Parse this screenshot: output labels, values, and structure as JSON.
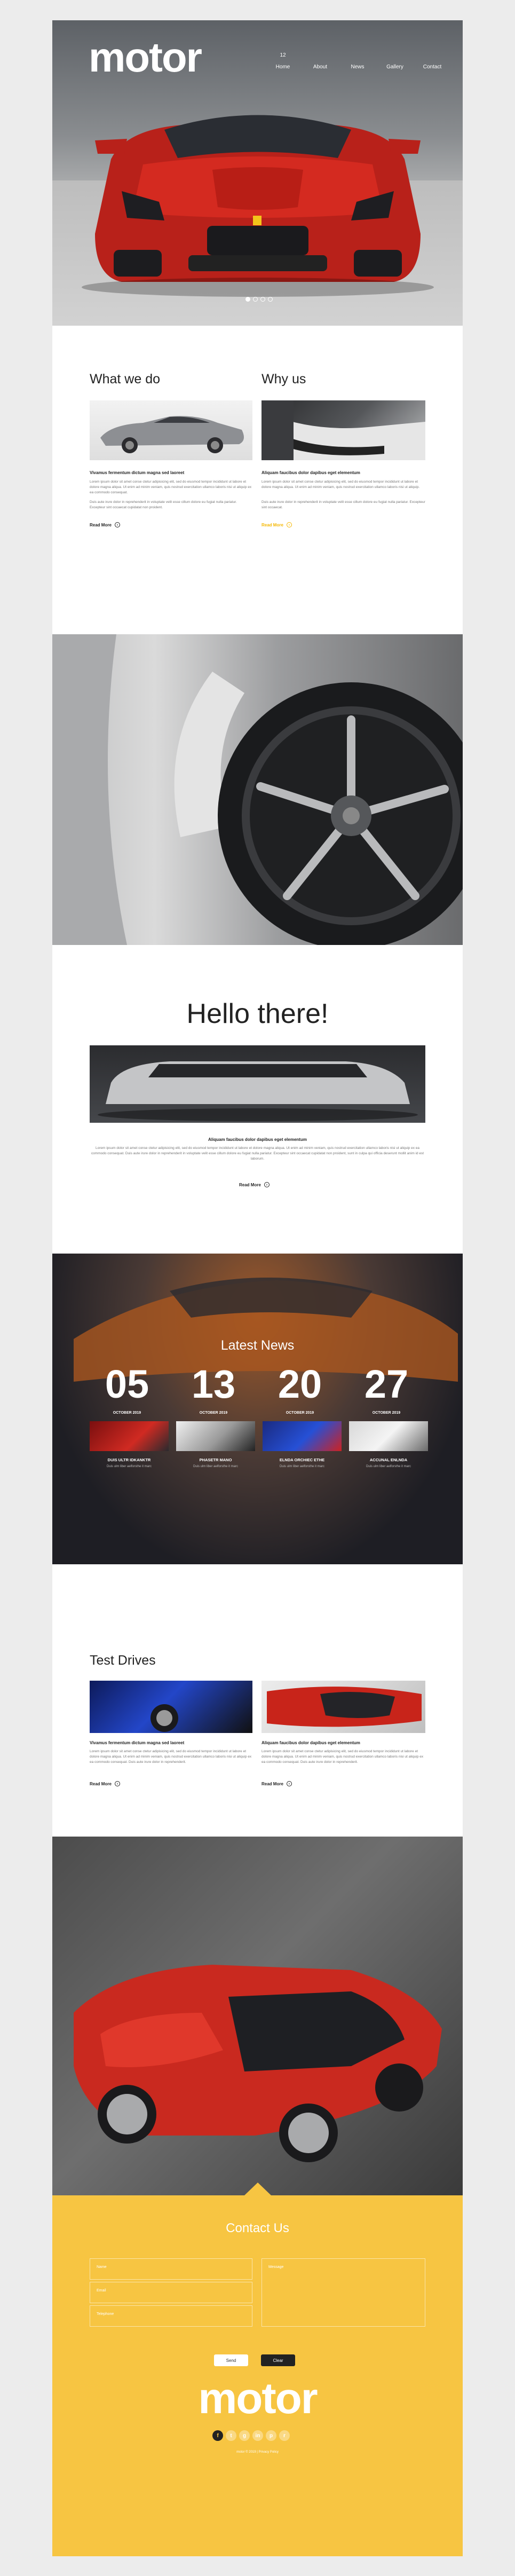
{
  "header": {
    "logo": "motor",
    "nav_number": "12",
    "nav": [
      "Home",
      "About",
      "News",
      "Gallery",
      "Contact"
    ],
    "slides": 4,
    "active_slide": 1
  },
  "what_we_do": {
    "title": "What we do",
    "subheading": "Vivamus fermentum dictum magna sed laoreet",
    "paragraph1": "Lorem ipsum dolor sit amet conse ctetur adipisicing elit, sed do eiusmod tempor incididunt ut labore et dolore magna aliqua. Ut enim ad minim veniam, quis nostrud exercitation ullamco laboris nisi ut aliquip ex ea commodo consequat.",
    "paragraph2": "Duis aute irure dolor in reprehenderit in voluptate velit esse cillum dolore eu fugiat nulla pariatur. Excepteur sint occaecat cupidatat non proident.",
    "read_more": "Read More"
  },
  "why_us": {
    "title": "Why us",
    "subheading": "Aliquam faucibus dolor dapibus eget elementum",
    "paragraph1": "Lorem ipsum dolor sit amet conse ctetur adipisicing elit, sed do eiusmod tempor incididunt ut labore et dolore magna aliqua. Ut enim ad minim veniam, quis nostrud exercitation ullamco laboris nisi ut aliquip.",
    "paragraph2": "Duis aute irure dolor in reprehenderit in voluptate velit esse cillum dolore eu fugiat nulla pariatur. Excepteur sint occaecat.",
    "read_more": "Read More"
  },
  "hello": {
    "title": "Hello there!",
    "subheading": "Aliquam faucibus dolor dapibus eget elementum",
    "paragraph": "Lorem ipsum dolor sit amet conse ctetur adipisicing elit, sed do eiusmod tempor incididunt ut labore et dolore magna aliqua. Ut enim ad minim veniam, quis nostrud exercitation ullamco laboris nisi ut aliquip ex ea commodo consequat. Duis aute irure dolor in reprehenderit in voluptate velit esse cillum dolore eu fugiat nulla pariatur. Excepteur sint occaecat cupidatat non proident, sunt in culpa qui officia deserunt mollit anim id est laborum.",
    "read_more": "Read More"
  },
  "news": {
    "title": "Latest News",
    "items": [
      {
        "day": "05",
        "month": "OCTOBER 2019",
        "caption": "DUIS ULTR IDKANKTR",
        "text": "Duis ulm liber aelforsthe it marc"
      },
      {
        "day": "13",
        "month": "OCTOBER 2019",
        "caption": "PHASETR MANO",
        "text": "Duis ulm liber aelforsthe it marc"
      },
      {
        "day": "20",
        "month": "OCTOBER 2019",
        "caption": "ELNDA ORCHIEC ETHE",
        "text": "Duis ulm liber aelforsthe it marc"
      },
      {
        "day": "27",
        "month": "OCTOBER 2019",
        "caption": "ACCUNAL ENLNDA",
        "text": "Duis ulm liber aelforsthe it marc"
      }
    ]
  },
  "test_drives": {
    "title": "Test Drives",
    "left": {
      "subheading": "Vivamus fermentum dictum magna sed laoreet",
      "paragraph": "Lorem ipsum dolor sit amet conse ctetur adipisicing elit, sed do eiusmod tempor incididunt ut labore et dolore magna aliqua. Ut enim ad minim veniam, quis nostrud exercitation ullamco laboris nisi ut aliquip ex ea commodo consequat. Duis aute irure dolor in reprehenderit.",
      "read_more": "Read More"
    },
    "right": {
      "subheading": "Aliquam faucibus dolor dapibus eget elementum",
      "paragraph": "Lorem ipsum dolor sit amet conse ctetur adipisicing elit, sed do eiusmod tempor incididunt ut labore et dolore magna aliqua. Ut enim ad minim veniam, quis nostrud exercitation ullamco laboris nisi ut aliquip ex ea commodo consequat. Duis aute irure dolor in reprehenderit.",
      "read_more": "Read More"
    }
  },
  "contact": {
    "title": "Contact Us",
    "name_placeholder": "Name",
    "email_placeholder": "Email",
    "phone_placeholder": "Telephone",
    "message_placeholder": "Message",
    "send_label": "Send",
    "clear_label": "Clear"
  },
  "footer": {
    "logo": "motor",
    "social": [
      "f",
      "t",
      "g",
      "in",
      "p",
      "r"
    ],
    "copyright": "motor © 2019 | Privacy Policy"
  },
  "colors": {
    "accent": "#f7c542",
    "dark": "#222222",
    "hero_red": "#c8241a"
  }
}
